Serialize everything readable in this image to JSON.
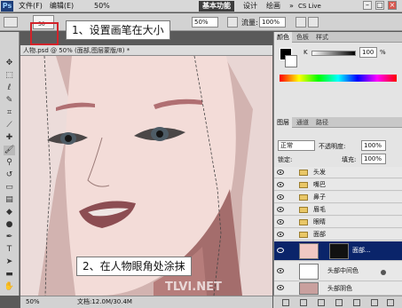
{
  "menubar": {
    "logo": "Ps",
    "items": [
      "文件(F)",
      "编辑(E)"
    ],
    "zoom": "50%",
    "workspaces": {
      "basic": "基本功能",
      "design": "设计",
      "paint": "绘画",
      "more": "»"
    },
    "cslive": "CS Live",
    "controls": [
      "–",
      "□",
      "×"
    ]
  },
  "options": {
    "brush_size": "30",
    "opacity_value": "50%",
    "flow_label": "流量:",
    "flow_value": "100%"
  },
  "callouts": {
    "step1": "1、设置画笔在大小",
    "step2": "2、在人物眼角处涂抹"
  },
  "document": {
    "tab_title": "人物.psd @ 50% (面部,图层蒙版/8) *",
    "status_zoom": "50%",
    "status_doc": "文档:12.0M/30.4M"
  },
  "color_panel": {
    "tabs": [
      "颜色",
      "色板",
      "样式"
    ],
    "k_label": "K",
    "k_value": "100",
    "k_unit": "%"
  },
  "layers_panel": {
    "tabs": [
      "图层",
      "通道",
      "路径"
    ],
    "blend_mode": "正常",
    "opacity_label": "不透明度:",
    "opacity_value": "100%",
    "lock_label": "锁定:",
    "fill_label": "填充:",
    "fill_value": "100%",
    "layers": [
      {
        "name": "头发",
        "type": "group"
      },
      {
        "name": "嘴巴",
        "type": "group"
      },
      {
        "name": "鼻子",
        "type": "group"
      },
      {
        "name": "眉毛",
        "type": "group"
      },
      {
        "name": "眼睛",
        "type": "group"
      },
      {
        "name": "面部",
        "type": "group-open"
      }
    ],
    "sublayers": [
      {
        "name": "面部...",
        "selected": true
      },
      {
        "name": "头部中间色",
        "selected": false
      },
      {
        "name": "头部阴色",
        "selected": false
      }
    ]
  },
  "watermark": "TLVI.NET",
  "colors": {
    "skin": "#f2d9d6",
    "hair_bg": "#c9a9a6",
    "shadow": "#a46d6c",
    "selection": "#0a246a",
    "callout_border": "#d2232a"
  }
}
